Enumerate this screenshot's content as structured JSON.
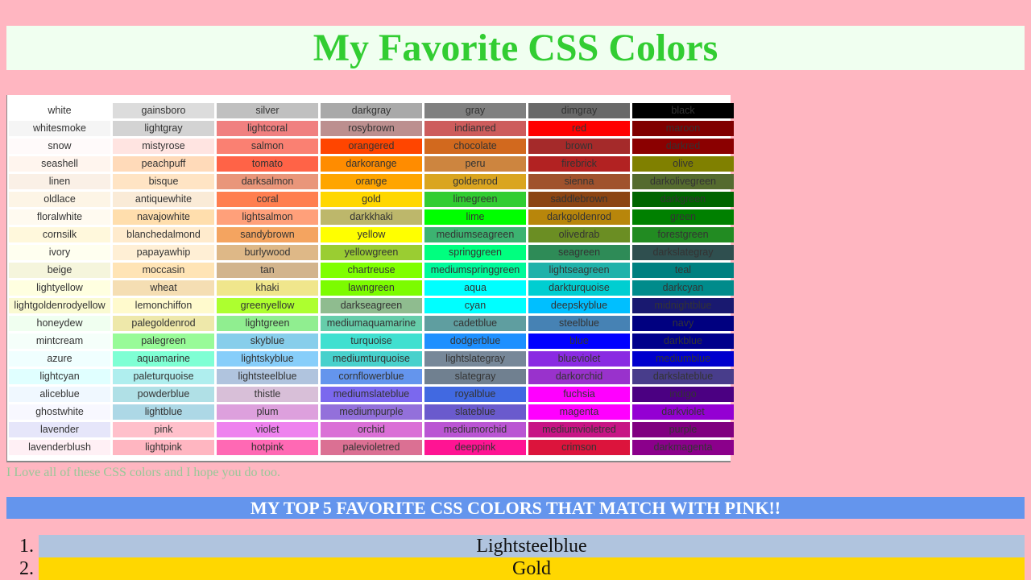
{
  "title": "My Favorite CSS Colors",
  "color_chart": {
    "rows": [
      [
        "white",
        "gainsboro",
        "silver",
        "darkgray",
        "gray",
        "dimgray",
        "black"
      ],
      [
        "whitesmoke",
        "lightgray",
        "lightcoral",
        "rosybrown",
        "indianred",
        "red",
        "maroon"
      ],
      [
        "snow",
        "mistyrose",
        "salmon",
        "orangered",
        "chocolate",
        "brown",
        "darkred"
      ],
      [
        "seashell",
        "peachpuff",
        "tomato",
        "darkorange",
        "peru",
        "firebrick",
        "olive"
      ],
      [
        "linen",
        "bisque",
        "darksalmon",
        "orange",
        "goldenrod",
        "sienna",
        "darkolivegreen"
      ],
      [
        "oldlace",
        "antiquewhite",
        "coral",
        "gold",
        "limegreen",
        "saddlebrown",
        "darkgreen"
      ],
      [
        "floralwhite",
        "navajowhite",
        "lightsalmon",
        "darkkhaki",
        "lime",
        "darkgoldenrod",
        "green"
      ],
      [
        "cornsilk",
        "blanchedalmond",
        "sandybrown",
        "yellow",
        "mediumseagreen",
        "olivedrab",
        "forestgreen"
      ],
      [
        "ivory",
        "papayawhip",
        "burlywood",
        "yellowgreen",
        "springgreen",
        "seagreen",
        "darkslategray"
      ],
      [
        "beige",
        "moccasin",
        "tan",
        "chartreuse",
        "mediumspringgreen",
        "lightseagreen",
        "teal"
      ],
      [
        "lightyellow",
        "wheat",
        "khaki",
        "lawngreen",
        "aqua",
        "darkturquoise",
        "darkcyan"
      ],
      [
        "lightgoldenrodyellow",
        "lemonchiffon",
        "greenyellow",
        "darkseagreen",
        "cyan",
        "deepskyblue",
        "midnightblue"
      ],
      [
        "honeydew",
        "palegoldenrod",
        "lightgreen",
        "mediumaquamarine",
        "cadetblue",
        "steelblue",
        "navy"
      ],
      [
        "mintcream",
        "palegreen",
        "skyblue",
        "turquoise",
        "dodgerblue",
        "blue",
        "darkblue"
      ],
      [
        "azure",
        "aquamarine",
        "lightskyblue",
        "mediumturquoise",
        "lightslategray",
        "blueviolet",
        "mediumblue"
      ],
      [
        "lightcyan",
        "paleturquoise",
        "lightsteelblue",
        "cornflowerblue",
        "slategray",
        "darkorchid",
        "darkslateblue"
      ],
      [
        "aliceblue",
        "powderblue",
        "thistle",
        "mediumslateblue",
        "royalblue",
        "fuchsia",
        "indigo"
      ],
      [
        "ghostwhite",
        "lightblue",
        "plum",
        "mediumpurple",
        "slateblue",
        "magenta",
        "darkviolet"
      ],
      [
        "lavender",
        "pink",
        "violet",
        "orchid",
        "mediumorchid",
        "mediumvioletred",
        "purple"
      ],
      [
        "lavenderblush",
        "lightpink",
        "hotpink",
        "palevioletred",
        "deeppink",
        "crimson",
        "darkmagenta"
      ]
    ],
    "display_names": {
      "gainsboro": "gainsboro"
    }
  },
  "caption": "I Love all of these CSS colors and I hope you do too.",
  "top5_heading": "MY TOP 5 FAVORITE CSS COLORS THAT MATCH WITH PINK!!",
  "top5": [
    {
      "number": "1.",
      "label": "Lightsteelblue",
      "color": "#b0c4de"
    },
    {
      "number": "2.",
      "label": "Gold",
      "color": "#ffd700"
    }
  ],
  "colors": {
    "page_bg": "#ffb6c1",
    "title_bg": "#f0fff0",
    "title_text": "#32cd32",
    "heading_bg": "#6495ed"
  }
}
